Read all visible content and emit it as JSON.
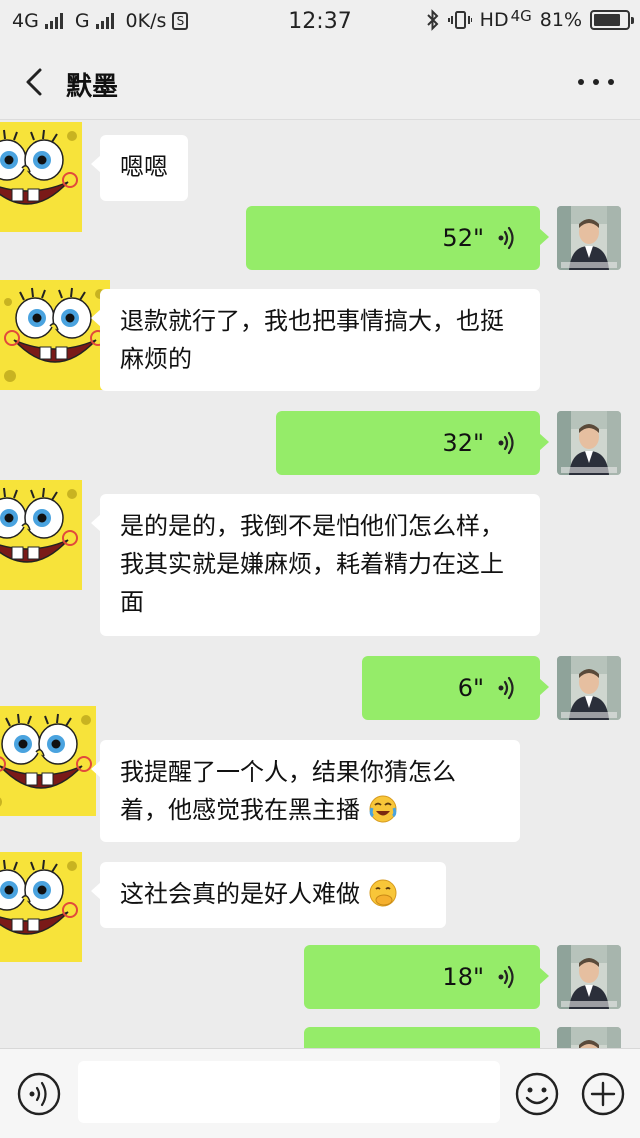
{
  "status_bar": {
    "signal1": "4G",
    "signal2": "G",
    "speed": "0K/s",
    "time": "12:37",
    "network": "HD",
    "network_type": "4G",
    "battery": "81%",
    "battery_level": 0.81
  },
  "header": {
    "title": "默墨"
  },
  "messages": [
    {
      "side": "in",
      "text": "嗯嗯"
    },
    {
      "side": "out",
      "type": "voice",
      "duration": "52\""
    },
    {
      "side": "in",
      "text": "退款就行了，我也把事情搞大，也挺麻烦的"
    },
    {
      "side": "out",
      "type": "voice",
      "duration": "32\""
    },
    {
      "side": "in",
      "text": "是的是的，我倒不是怕他们怎么样，我其实就是嫌麻烦，耗着精力在这上面"
    },
    {
      "side": "out",
      "type": "voice",
      "duration": "6\""
    },
    {
      "side": "in",
      "text": "我提醒了一个人，结果你猜怎么着，他感觉我在黑主播",
      "emoji": "crying-laughing-emoji"
    },
    {
      "side": "in",
      "text": "这社会真的是好人难做",
      "emoji": "hand-over-mouth-emoji"
    },
    {
      "side": "out",
      "type": "voice",
      "duration": "18\""
    }
  ],
  "icons": {
    "back": "chevron-left-icon",
    "more": "more-dots-icon",
    "voice": "voice-wave-icon",
    "emoji": "smiley-icon",
    "plus": "plus-icon"
  },
  "colors": {
    "outgoing_bubble": "#95ec69",
    "incoming_bubble": "#ffffff",
    "background": "#ececec"
  }
}
